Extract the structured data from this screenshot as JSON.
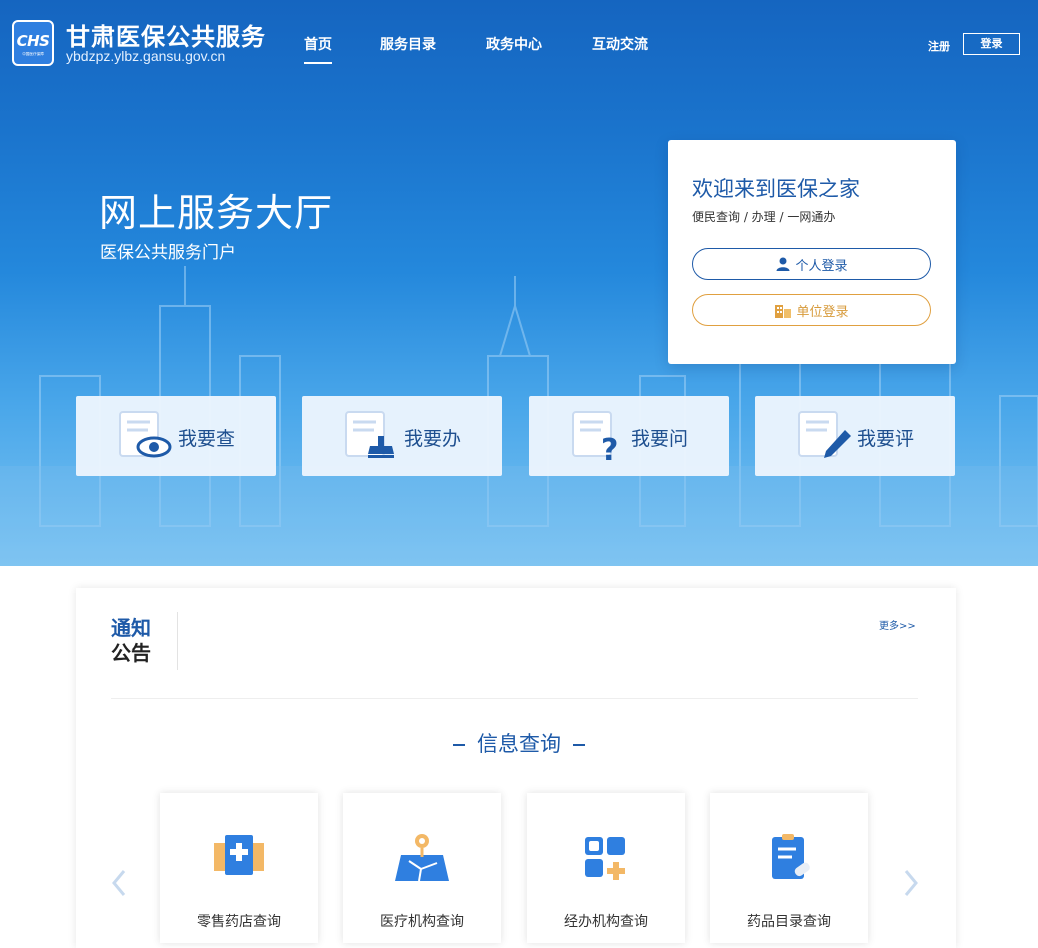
{
  "header": {
    "logo_text": "CHS",
    "logo_subtext": "中国医疗保障",
    "site_title": "甘肃医保公共服务",
    "site_url": "ybdzpz.ylbz.gansu.gov.cn",
    "nav": [
      {
        "label": "首页",
        "active": true
      },
      {
        "label": "服务目录",
        "active": false
      },
      {
        "label": "政务中心",
        "active": false
      },
      {
        "label": "互动交流",
        "active": false
      }
    ],
    "register_label": "注册",
    "login_label": "登录"
  },
  "hero": {
    "title": "网上服务大厅",
    "subtitle": "医保公共服务门户"
  },
  "login_card": {
    "title": "欢迎来到医保之家",
    "subtitle": "便民查询 / 办理 / 一网通办",
    "personal_login": "个人登录",
    "company_login": "单位登录"
  },
  "quick_actions": [
    {
      "label": "我要查",
      "icon": "doc-eye-icon"
    },
    {
      "label": "我要办",
      "icon": "doc-stamp-icon"
    },
    {
      "label": "我要问",
      "icon": "doc-question-icon"
    },
    {
      "label": "我要评",
      "icon": "doc-pen-icon"
    }
  ],
  "notice": {
    "title_line1": "通知",
    "title_line2": "公告",
    "more_label": "更多>>"
  },
  "info_query": {
    "heading": "信息查询",
    "items": [
      {
        "label": "零售药店查询",
        "icon": "pharmacy-icon"
      },
      {
        "label": "医疗机构查询",
        "icon": "map-location-icon"
      },
      {
        "label": "经办机构查询",
        "icon": "grid-plus-icon"
      },
      {
        "label": "药品目录查询",
        "icon": "clipboard-icon"
      }
    ]
  },
  "colors": {
    "primary": "#1e5aa8",
    "accent_orange": "#e0a040",
    "hero_top": "#1565c0",
    "hero_bottom": "#7cc4f2"
  }
}
